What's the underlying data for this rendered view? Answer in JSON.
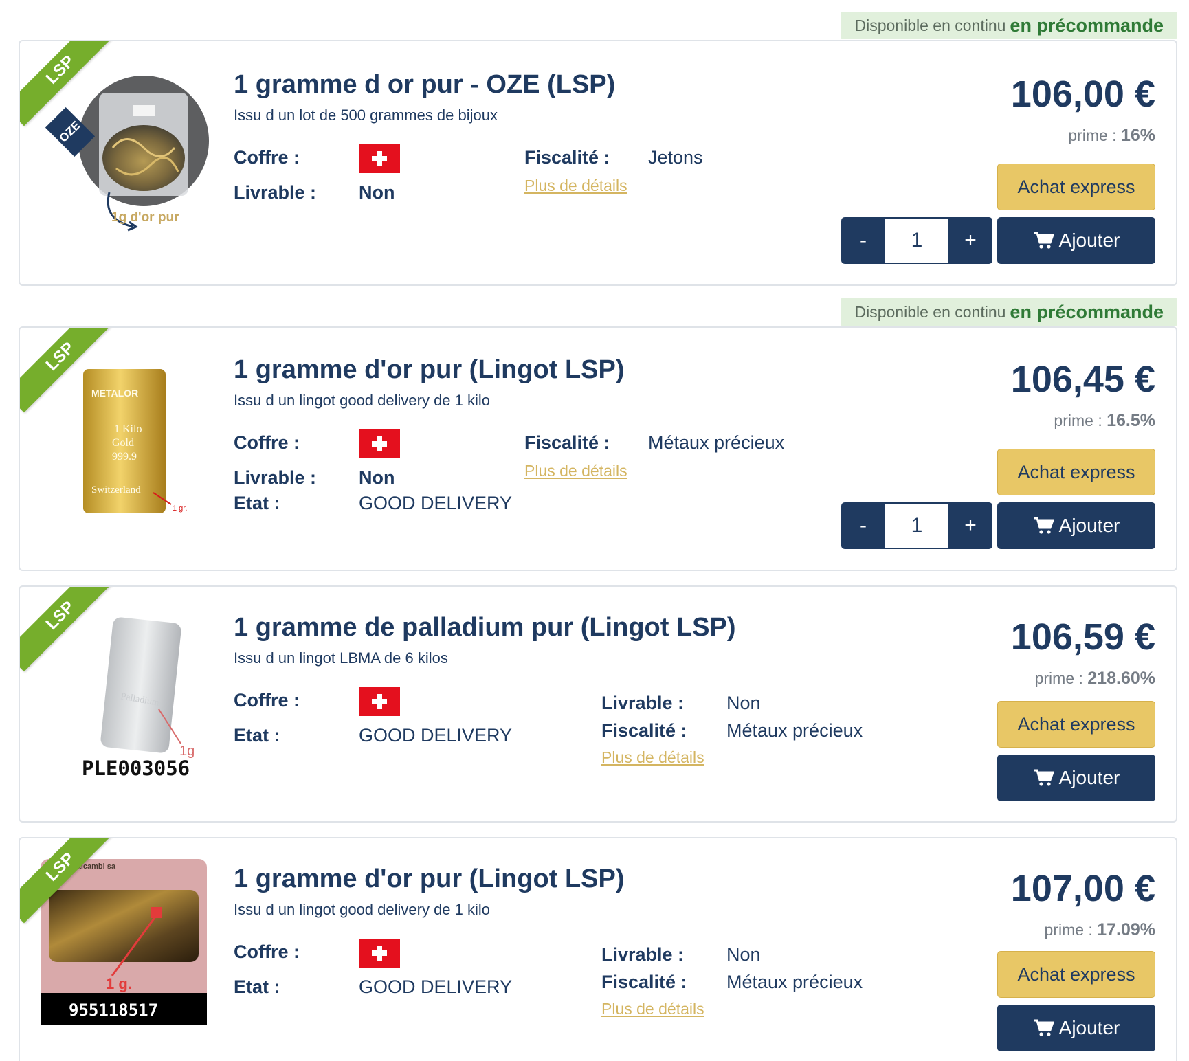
{
  "availability": {
    "prefix": "Disponible en continu",
    "emphasis": "en précommande"
  },
  "labels": {
    "coffre": "Coffre :",
    "livrable": "Livrable :",
    "fiscalite": "Fiscalité :",
    "etat": "Etat :",
    "details": "Plus de détails",
    "prime": "prime :",
    "express": "Achat express",
    "add": "Ajouter",
    "minus": "-",
    "plus": "+"
  },
  "colors": {
    "navy": "#1f3a60",
    "gold_button": "#e8c766",
    "ribbon_green": "#76ae2c",
    "availability_bg": "#e1f0dc",
    "swiss_red": "#e4101e"
  },
  "products": [
    {
      "ribbon": "LSP",
      "subribbon": "OZE",
      "image_icon": "jewelry-bag-icon",
      "image_caption": "1g d'or pur",
      "title": "1 gramme d or pur - OZE (LSP)",
      "subtitle": "Issu d un lot de 500 grammes de bijoux",
      "livrable": "Non",
      "fiscalite": "Jetons",
      "price": "106,00 €",
      "prime": "16%",
      "quantity": "1"
    },
    {
      "ribbon": "LSP",
      "image_icon": "gold-bar-icon",
      "image_text": [
        "METALOR",
        "1 Kilo",
        "Gold",
        "999.9",
        "Switzerland"
      ],
      "image_caption": "1 gr.",
      "title": "1 gramme d'or pur (Lingot LSP)",
      "subtitle": "Issu d un lingot good delivery de 1 kilo",
      "livrable": "Non",
      "etat": "GOOD DELIVERY",
      "fiscalite": "Métaux précieux",
      "price": "106,45 €",
      "prime": "16.5%",
      "quantity": "1"
    },
    {
      "ribbon": "LSP",
      "image_icon": "palladium-bar-icon",
      "image_caption": "PLE003056",
      "image_text": [
        "Palladium",
        "1g"
      ],
      "title": "1 gramme de palladium pur (Lingot LSP)",
      "subtitle": "Issu d un lingot LBMA de 6 kilos",
      "etat": "GOOD DELIVERY",
      "livrable": "Non",
      "fiscalite": "Métaux précieux",
      "price": "106,59 €",
      "prime": "218.60%"
    },
    {
      "ribbon": "LSP",
      "image_icon": "valcambi-gold-bar-icon",
      "image_text": [
        "Valcambi sa",
        "1 g."
      ],
      "image_caption": "955118517",
      "title": "1 gramme d'or pur (Lingot LSP)",
      "subtitle": "Issu d un lingot good delivery de 1 kilo",
      "etat": "GOOD DELIVERY",
      "livrable": "Non",
      "fiscalite": "Métaux précieux",
      "price": "107,00 €",
      "prime": "17.09%"
    }
  ]
}
